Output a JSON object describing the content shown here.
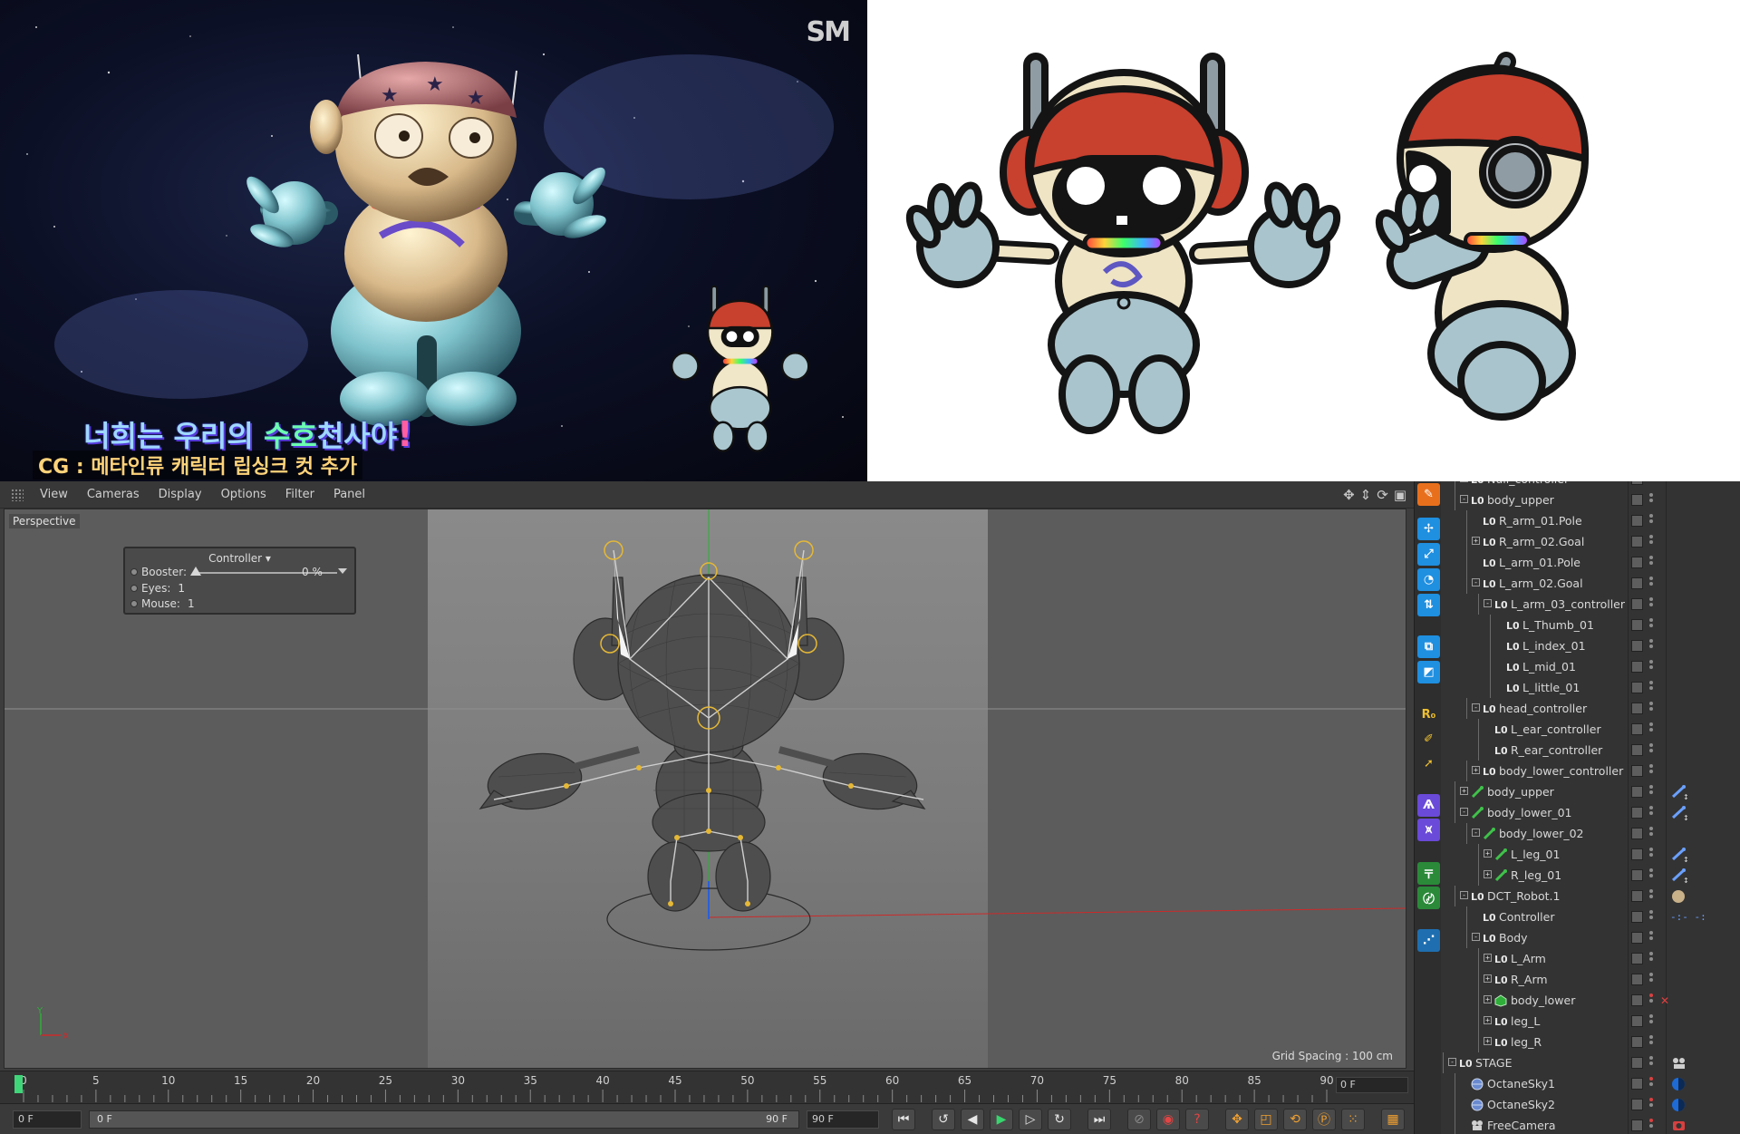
{
  "video_frame": {
    "logo": "SM",
    "subtitle_main_1": "너희는 ",
    "subtitle_main_2": "우리의 ",
    "subtitle_main_3": "수호",
    "subtitle_main_4": "천사야",
    "subtitle_main_5": "!",
    "subtitle_cg": "CG : 메타인류 캐릭터 립싱크 컷 추가"
  },
  "viewport": {
    "menu": [
      "View",
      "Cameras",
      "Display",
      "Options",
      "Filter",
      "Panel"
    ],
    "camera_label": "Perspective",
    "hud": {
      "title": "Controller",
      "booster_label": "Booster:",
      "booster_value": "0 %",
      "booster_fraction": 0.0,
      "eyes_label": "Eyes:",
      "eyes_value": "1",
      "mouse_label": "Mouse:",
      "mouse_value": "1"
    },
    "grid_spacing": "Grid Spacing : 100 cm",
    "axis_y": "Y",
    "axis_x": "X"
  },
  "timeline": {
    "ticks": [
      "0",
      "5",
      "10",
      "15",
      "20",
      "25",
      "30",
      "35",
      "40",
      "45",
      "50",
      "55",
      "60",
      "65",
      "70",
      "75",
      "80",
      "85",
      "90"
    ],
    "current_frame": "0 F"
  },
  "transport": {
    "start_frame": "0 F",
    "range_start": "0 F",
    "range_end": "90 F",
    "end_frame": "90 F"
  },
  "object_manager": {
    "rows": [
      {
        "name": "Null_controller",
        "depth": 1,
        "expand": "-",
        "icon": "null"
      },
      {
        "name": "body_upper",
        "depth": 1,
        "expand": "-",
        "icon": "null"
      },
      {
        "name": "R_arm_01.Pole",
        "depth": 2,
        "expand": "",
        "icon": "null"
      },
      {
        "name": "R_arm_02.Goal",
        "depth": 2,
        "expand": "+",
        "icon": "null"
      },
      {
        "name": "L_arm_01.Pole",
        "depth": 2,
        "expand": "",
        "icon": "null"
      },
      {
        "name": "L_arm_02.Goal",
        "depth": 2,
        "expand": "-",
        "icon": "null"
      },
      {
        "name": "L_arm_03_controller",
        "depth": 3,
        "expand": "-",
        "icon": "null"
      },
      {
        "name": "L_Thumb_01",
        "depth": 4,
        "expand": "",
        "icon": "null"
      },
      {
        "name": "L_index_01",
        "depth": 4,
        "expand": "",
        "icon": "null"
      },
      {
        "name": "L_mid_01",
        "depth": 4,
        "expand": "",
        "icon": "null"
      },
      {
        "name": "L_little_01",
        "depth": 4,
        "expand": "",
        "icon": "null"
      },
      {
        "name": "head_controller",
        "depth": 2,
        "expand": "-",
        "icon": "null"
      },
      {
        "name": "L_ear_controller",
        "depth": 3,
        "expand": "",
        "icon": "null"
      },
      {
        "name": "R_ear_controller",
        "depth": 3,
        "expand": "",
        "icon": "null"
      },
      {
        "name": "body_lower_controller",
        "depth": 2,
        "expand": "+",
        "icon": "null"
      },
      {
        "name": "body_upper",
        "depth": 1,
        "expand": "+",
        "icon": "joint",
        "tag": "ik"
      },
      {
        "name": "body_lower_01",
        "depth": 1,
        "expand": "-",
        "icon": "joint",
        "tag": "ik"
      },
      {
        "name": "body_lower_02",
        "depth": 2,
        "expand": "-",
        "icon": "joint"
      },
      {
        "name": "L_leg_01",
        "depth": 3,
        "expand": "+",
        "icon": "joint",
        "tag": "ik"
      },
      {
        "name": "R_leg_01",
        "depth": 3,
        "expand": "+",
        "icon": "joint",
        "tag": "ik"
      },
      {
        "name": "DCT_Robot.1",
        "depth": 1,
        "expand": "-",
        "icon": "null",
        "tag": "material"
      },
      {
        "name": "Controller",
        "depth": 2,
        "expand": "",
        "icon": "null",
        "tag": "userdata"
      },
      {
        "name": "Body",
        "depth": 2,
        "expand": "-",
        "icon": "null"
      },
      {
        "name": "L_Arm",
        "depth": 3,
        "expand": "+",
        "icon": "null"
      },
      {
        "name": "R_Arm",
        "depth": 3,
        "expand": "+",
        "icon": "null"
      },
      {
        "name": "body_lower",
        "depth": 3,
        "expand": "+",
        "icon": "poly",
        "tag": "x"
      },
      {
        "name": "leg_L",
        "depth": 3,
        "expand": "+",
        "icon": "null"
      },
      {
        "name": "leg_R",
        "depth": 3,
        "expand": "+",
        "icon": "null"
      },
      {
        "name": "STAGE",
        "depth": 0,
        "expand": "-",
        "icon": "null",
        "tag": "stage"
      },
      {
        "name": "OctaneSky1",
        "depth": 1,
        "expand": "",
        "icon": "sky",
        "tag": "octane"
      },
      {
        "name": "OctaneSky2",
        "depth": 1,
        "expand": "",
        "icon": "sky",
        "tag": "octane"
      },
      {
        "name": "FreeCamera",
        "depth": 1,
        "expand": "",
        "icon": "camera",
        "tag": "camtag"
      }
    ]
  },
  "colors": {
    "accent_green": "#3fd67a",
    "tool_blue": "#1f8fe0",
    "tool_orange": "#e8701d",
    "axis_red": "#cc2a2a",
    "axis_green": "#2fae3a",
    "axis_blue": "#2b5fd8"
  }
}
